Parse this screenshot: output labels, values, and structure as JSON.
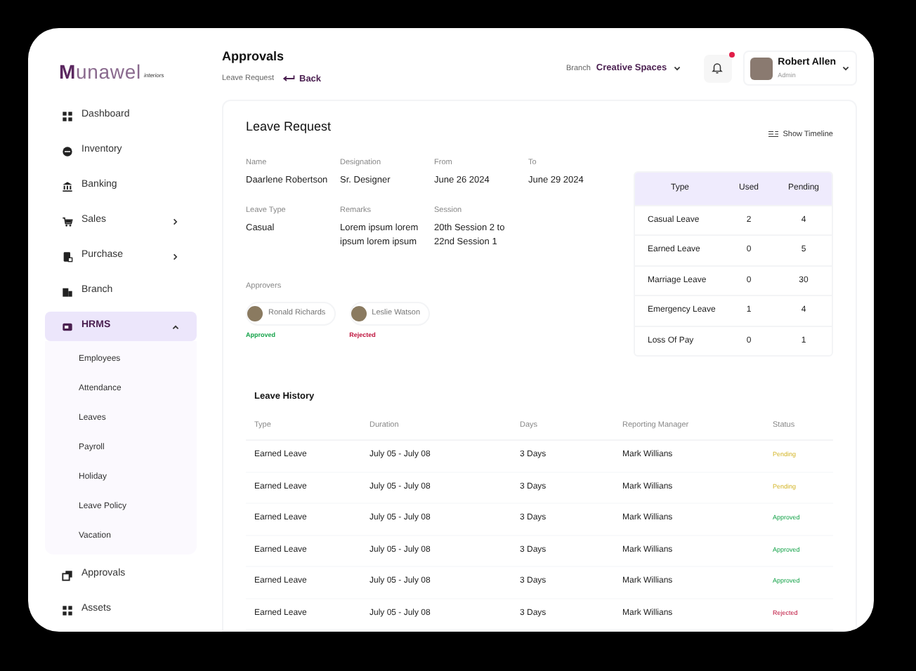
{
  "logo": {
    "text": "Munawel",
    "tagline": "interiors"
  },
  "sidebar": {
    "items": [
      {
        "label": "Dashboard",
        "selected": false
      },
      {
        "label": "Inventory",
        "selected": false
      },
      {
        "label": "Banking",
        "selected": false
      },
      {
        "label": "Sales",
        "selected": false,
        "expanded": false
      },
      {
        "label": "Purchase",
        "selected": false,
        "expanded": false
      },
      {
        "label": "Branch",
        "selected": false
      },
      {
        "label": "HRMS",
        "selected": true,
        "expanded": true,
        "children": [
          {
            "label": "Employees"
          },
          {
            "label": "Attendance"
          },
          {
            "label": "Leaves"
          },
          {
            "label": "Payroll"
          },
          {
            "label": "Holiday"
          },
          {
            "label": "Leave Policy"
          },
          {
            "label": "Vacation"
          }
        ]
      },
      {
        "label": "Approvals",
        "selected": false
      },
      {
        "label": "Assets",
        "selected": false
      }
    ]
  },
  "header": {
    "title": "Approvals",
    "breadcrumb": "Leave Request",
    "back": "Back",
    "branch_label": "Branch",
    "branch_value": "Creative Spaces",
    "notification_dot": true,
    "user": {
      "name": "Robert Allen",
      "role": "Admin"
    }
  },
  "leave_request": {
    "title": "Leave Request",
    "show_timeline": "Show Timeline",
    "fields": [
      {
        "label": "Name",
        "value": "Daarlene Robertson"
      },
      {
        "label": "Designation",
        "value": "Sr. Designer"
      },
      {
        "label": "From",
        "value": "June 26 2024"
      },
      {
        "label": "To",
        "value": "June 29 2024"
      },
      {
        "label": "Leave Type",
        "value": "Casual"
      },
      {
        "label": "Remarks",
        "value": "Lorem ipsum lorem ipsum lorem ipsum"
      },
      {
        "label": "Session",
        "value": "20th Session 2 to 22nd Session 1"
      }
    ],
    "approvers_label": "Approvers",
    "approvers": [
      {
        "name": "Ronald Richards",
        "status": "Approved",
        "kind": "approved"
      },
      {
        "name": "Leslie Watson",
        "status": "Rejected",
        "kind": "rejected"
      }
    ],
    "summary": {
      "columns": [
        "Type",
        "Used",
        "Pending"
      ],
      "rows": [
        [
          "Casual Leave",
          "2",
          "4"
        ],
        [
          "Earned Leave",
          "0",
          "5"
        ],
        [
          "Marriage Leave",
          "0",
          "30"
        ],
        [
          "Emergency Leave",
          "1",
          "4"
        ],
        [
          "Loss Of Pay",
          "0",
          "1"
        ]
      ]
    }
  },
  "leave_history": {
    "title": "Leave History",
    "columns": [
      "Type",
      "Duration",
      "Days",
      "Reporting Manager",
      "Status"
    ],
    "rows": [
      {
        "type": "Earned Leave",
        "duration": "July 05 - July 08",
        "days": "3 Days",
        "manager": "Mark Willians",
        "status": "Pending",
        "kind": "pending"
      },
      {
        "type": "Earned Leave",
        "duration": "July 05 - July 08",
        "days": "3 Days",
        "manager": "Mark Willians",
        "status": "Pending",
        "kind": "pending"
      },
      {
        "type": "Earned Leave",
        "duration": "July 05 - July 08",
        "days": "3 Days",
        "manager": "Mark Willians",
        "status": "Approved",
        "kind": "approved"
      },
      {
        "type": "Earned Leave",
        "duration": "July 05 - July 08",
        "days": "3 Days",
        "manager": "Mark Willians",
        "status": "Approved",
        "kind": "approved"
      },
      {
        "type": "Earned Leave",
        "duration": "July 05 - July 08",
        "days": "3 Days",
        "manager": "Mark Willians",
        "status": "Approved",
        "kind": "approved"
      },
      {
        "type": "Earned Leave",
        "duration": "July 05 - July 08",
        "days": "3 Days",
        "manager": "Mark Willians",
        "status": "Rejected",
        "kind": "rejected"
      }
    ]
  }
}
